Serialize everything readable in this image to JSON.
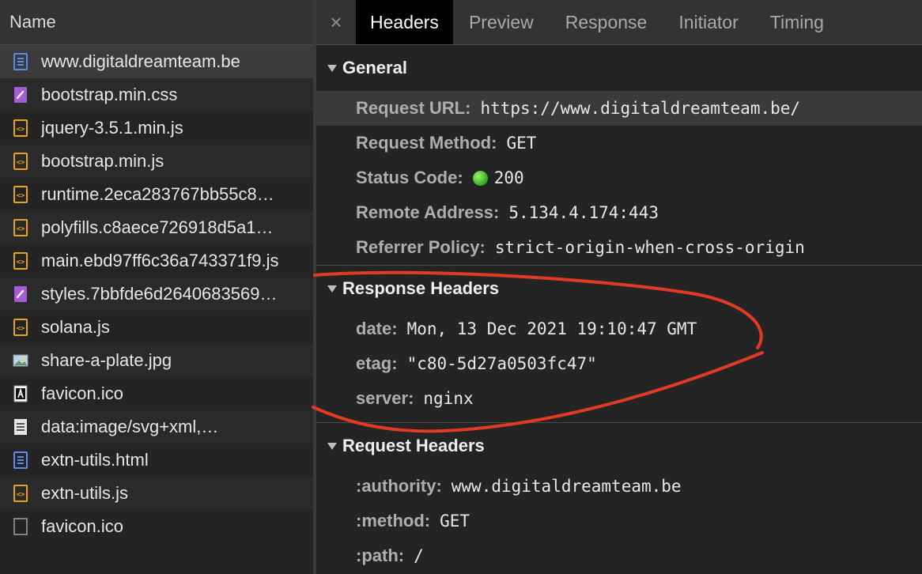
{
  "requests": {
    "header": "Name",
    "items": [
      {
        "name": "www.digitaldreamteam.be",
        "type": "doc"
      },
      {
        "name": "bootstrap.min.css",
        "type": "css"
      },
      {
        "name": "jquery-3.5.1.min.js",
        "type": "js"
      },
      {
        "name": "bootstrap.min.js",
        "type": "js"
      },
      {
        "name": "runtime.2eca283767bb55c8…",
        "type": "js"
      },
      {
        "name": "polyfills.c8aece726918d5a1…",
        "type": "js"
      },
      {
        "name": "main.ebd97ff6c36a743371f9.js",
        "type": "js"
      },
      {
        "name": "styles.7bbfde6d2640683569…",
        "type": "css"
      },
      {
        "name": "solana.js",
        "type": "js"
      },
      {
        "name": "share-a-plate.jpg",
        "type": "img"
      },
      {
        "name": "favicon.ico",
        "type": "favicon"
      },
      {
        "name": "data:image/svg+xml,…",
        "type": "svg"
      },
      {
        "name": "extn-utils.html",
        "type": "doc"
      },
      {
        "name": "extn-utils.js",
        "type": "js"
      },
      {
        "name": "favicon.ico",
        "type": "blank"
      }
    ]
  },
  "tabs": {
    "close": "×",
    "items": [
      "Headers",
      "Preview",
      "Response",
      "Initiator",
      "Timing"
    ],
    "active": "Headers"
  },
  "general": {
    "title": "General",
    "rows": [
      {
        "key": "Request URL:",
        "value": "https://www.digitaldreamteam.be/"
      },
      {
        "key": "Request Method:",
        "value": "GET"
      },
      {
        "key": "Status Code:",
        "value": "200"
      },
      {
        "key": "Remote Address:",
        "value": "5.134.4.174:443"
      },
      {
        "key": "Referrer Policy:",
        "value": "strict-origin-when-cross-origin"
      }
    ]
  },
  "response_headers": {
    "title": "Response Headers",
    "rows": [
      {
        "key": "date:",
        "value": "Mon, 13 Dec 2021 19:10:47 GMT"
      },
      {
        "key": "etag:",
        "value": "\"c80-5d27a0503fc47\""
      },
      {
        "key": "server:",
        "value": "nginx"
      }
    ]
  },
  "request_headers": {
    "title": "Request Headers",
    "rows": [
      {
        "key": ":authority:",
        "value": "www.digitaldreamteam.be"
      },
      {
        "key": ":method:",
        "value": "GET"
      },
      {
        "key": ":path:",
        "value": "/"
      }
    ]
  },
  "colors": {
    "js_icon": "#e8a317",
    "css_icon": "#a55bd8",
    "doc_icon": "#5a8bea",
    "status_ok": "#3db32a",
    "annotation": "#e03a25"
  }
}
